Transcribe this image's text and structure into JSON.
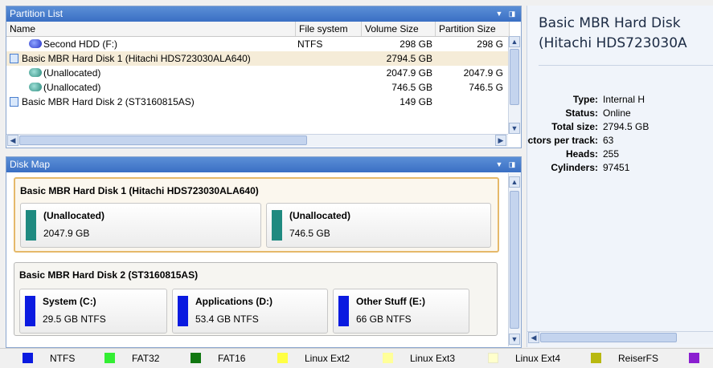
{
  "partition_list": {
    "title": "Partition List",
    "columns": [
      "Name",
      "File system",
      "Volume Size",
      "Partition Size"
    ],
    "rows": [
      {
        "name": "Second HDD (F:)",
        "fs": "NTFS",
        "vol": "298 GB",
        "part": "298 G",
        "icon": "partition-icon"
      },
      {
        "name": "Basic MBR Hard Disk 1 (Hitachi HDS723030ALA640)",
        "fs": "",
        "vol": "2794.5 GB",
        "part": "",
        "icon": "disk-icon"
      },
      {
        "name": "(Unallocated)",
        "fs": "",
        "vol": "2047.9 GB",
        "part": "2047.9 G",
        "icon": "partition-icon"
      },
      {
        "name": "(Unallocated)",
        "fs": "",
        "vol": "746.5 GB",
        "part": "746.5 G",
        "icon": "partition-icon"
      },
      {
        "name": "Basic MBR Hard Disk 2 (ST3160815AS)",
        "fs": "",
        "vol": "149 GB",
        "part": "",
        "icon": "disk-icon"
      }
    ]
  },
  "disk_map": {
    "title": "Disk Map",
    "disks": [
      {
        "title": "Basic MBR Hard Disk 1 (Hitachi HDS723030ALA640)",
        "partitions": [
          {
            "name": "(Unallocated)",
            "info": "2047.9 GB",
            "color": "#1f8a80"
          },
          {
            "name": "(Unallocated)",
            "info": "746.5 GB",
            "color": "#1f8a80"
          }
        ]
      },
      {
        "title": "Basic MBR Hard Disk 2 (ST3160815AS)",
        "partitions": [
          {
            "name": "System (C:)",
            "info": "29.5 GB NTFS",
            "color": "#0a1ae0"
          },
          {
            "name": "Applications (D:)",
            "info": "53.4 GB NTFS",
            "color": "#0a1ae0"
          },
          {
            "name": "Other Stuff (E:)",
            "info": "66 GB NTFS",
            "color": "#0a1ae0"
          }
        ]
      }
    ]
  },
  "properties": {
    "title_line1": "Basic MBR Hard Disk",
    "title_line2": "(Hitachi HDS723030A",
    "rows": [
      {
        "key": "Type:",
        "value": "Internal H"
      },
      {
        "key": "Status:",
        "value": "Online"
      },
      {
        "key": "Total size:",
        "value": "2794.5 GB"
      },
      {
        "key": "Sectors per track:",
        "value": "63"
      },
      {
        "key": "Heads:",
        "value": "255"
      },
      {
        "key": "Cylinders:",
        "value": "97451"
      }
    ]
  },
  "legend": [
    {
      "label": "NTFS",
      "color": "#0a1ae0"
    },
    {
      "label": "FAT32",
      "color": "#33ee33"
    },
    {
      "label": "FAT16",
      "color": "#117711"
    },
    {
      "label": "Linux Ext2",
      "color": "#ffff44"
    },
    {
      "label": "Linux Ext3",
      "color": "#ffff99"
    },
    {
      "label": "Linux Ext4",
      "color": "#ffffcc"
    },
    {
      "label": "ReiserFS",
      "color": "#b8b810"
    },
    {
      "label": "",
      "color": "#8a1ed0"
    }
  ]
}
